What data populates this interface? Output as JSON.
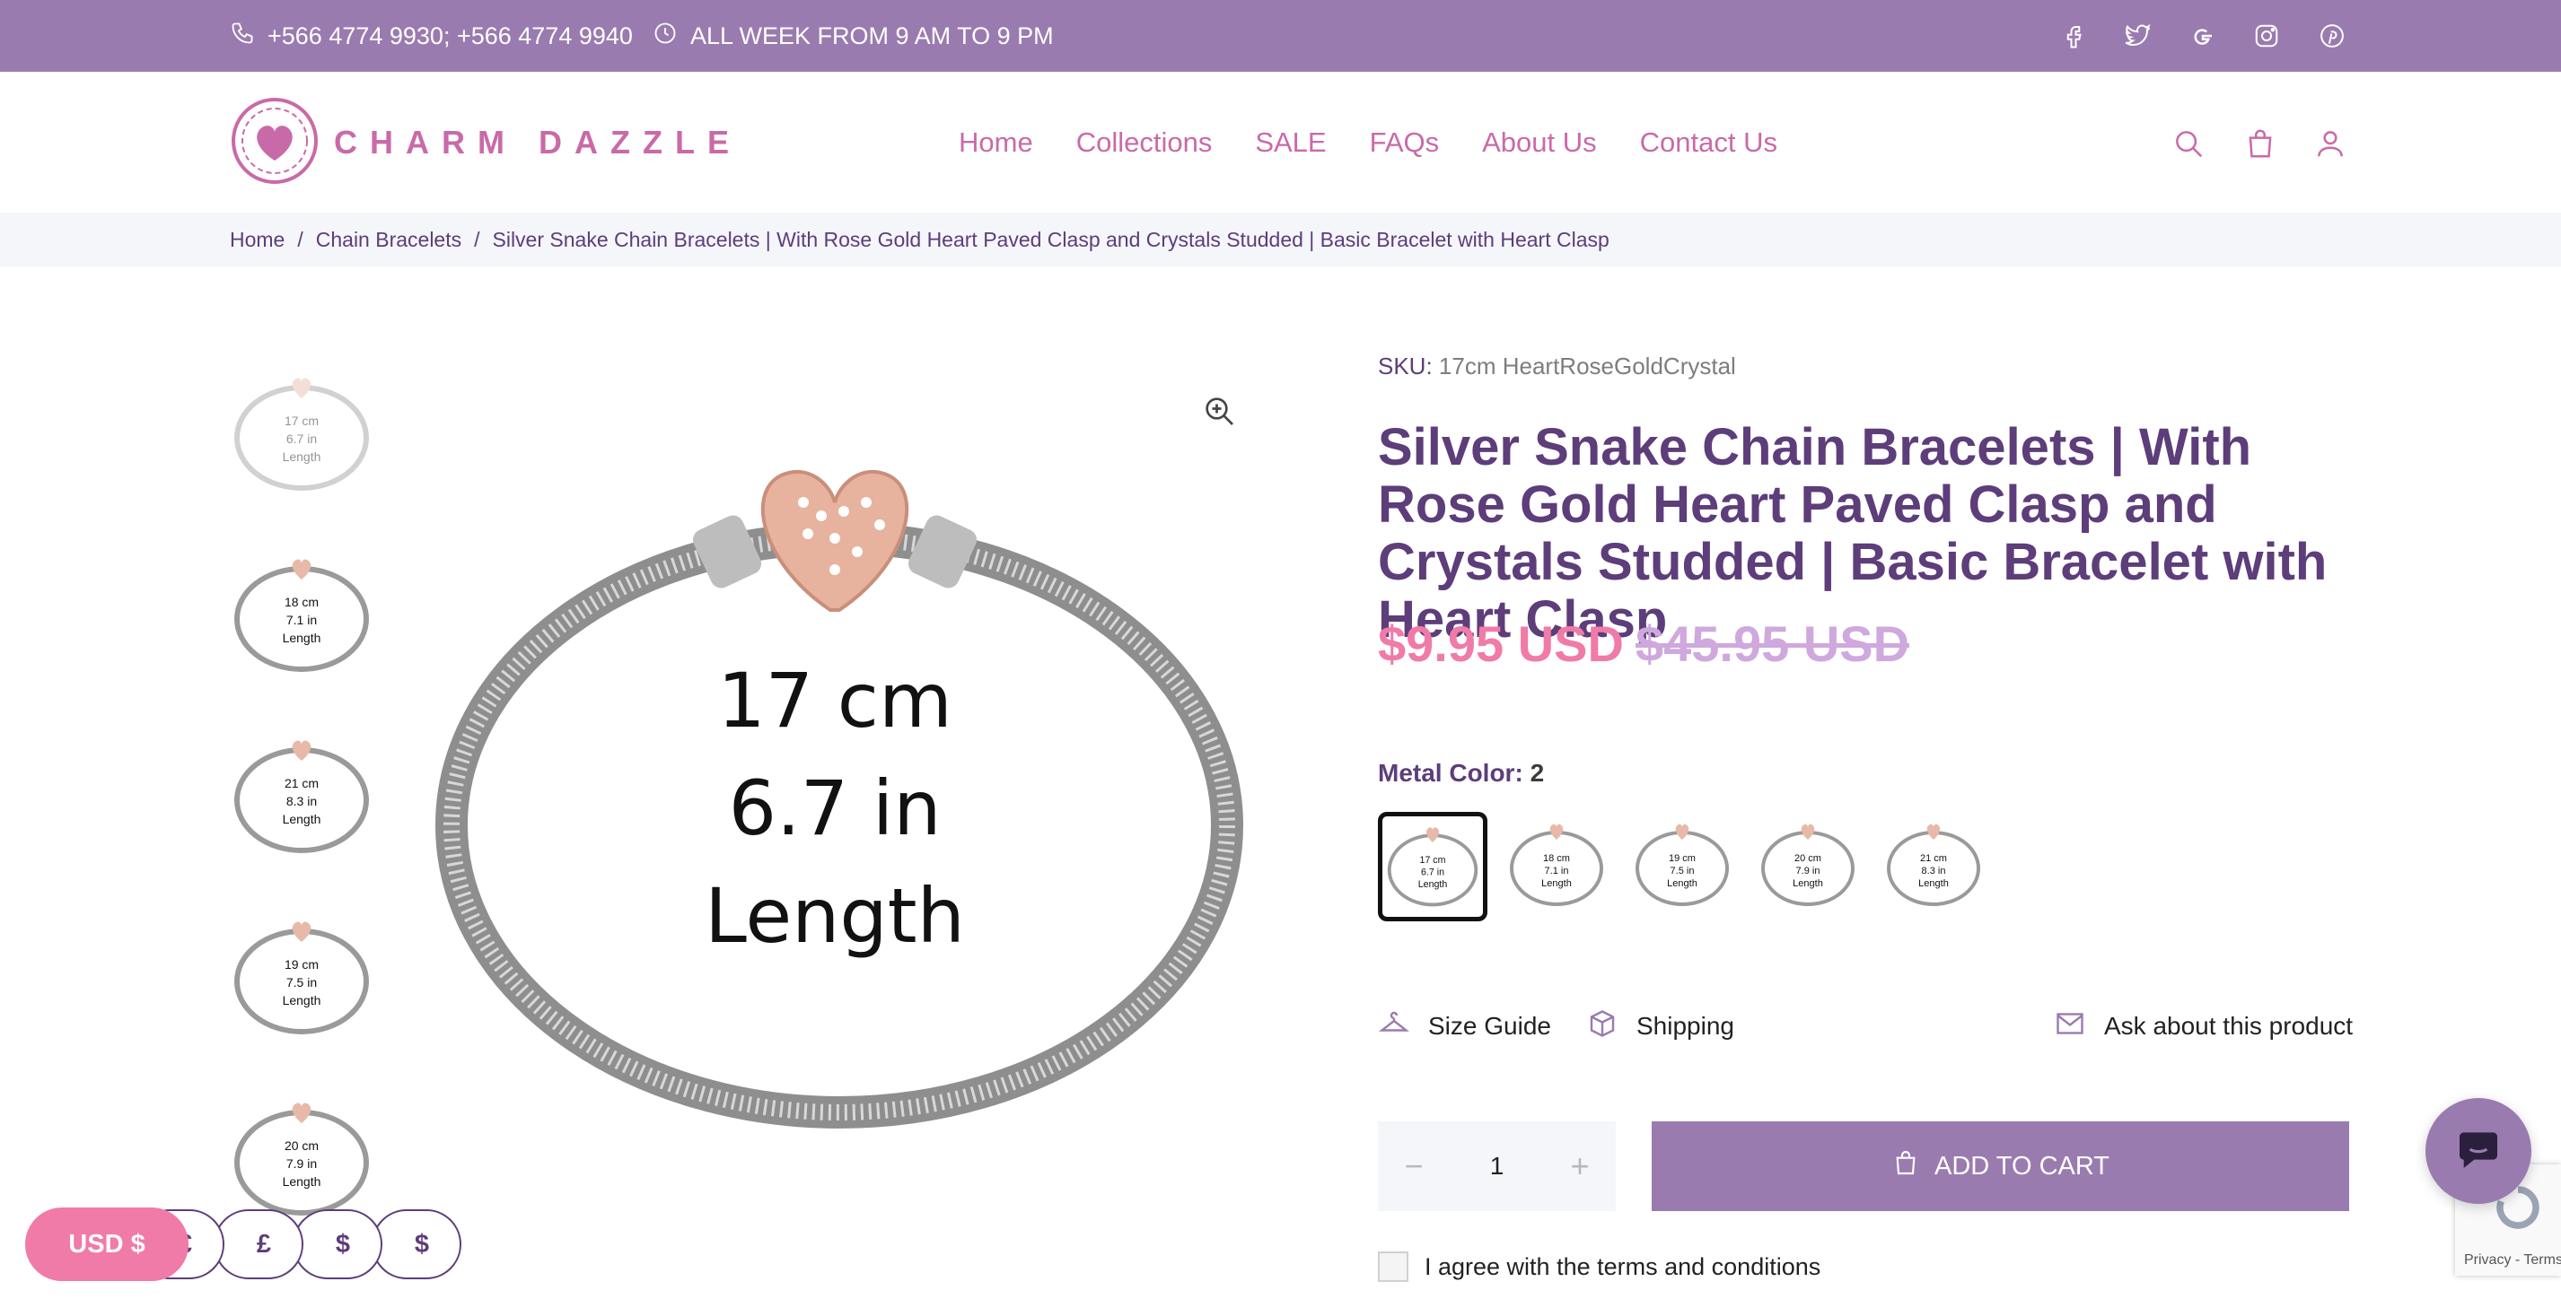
{
  "topbar": {
    "phone": "+566 4774 9930; +566 4774 9940",
    "hours": "ALL WEEK FROM 9 AM TO 9 PM",
    "socials": [
      "facebook-icon",
      "twitter-icon",
      "google-icon",
      "instagram-icon",
      "pinterest-icon"
    ]
  },
  "header": {
    "logo_text": "CHARM DAZZLE",
    "nav": [
      "Home",
      "Collections",
      "SALE",
      "FAQs",
      "About Us",
      "Contact Us"
    ],
    "icons": [
      "search-icon",
      "cart-icon",
      "account-icon"
    ]
  },
  "breadcrumb": {
    "items": [
      "Home",
      "Chain Bracelets",
      "Silver Snake Chain Bracelets | With Rose Gold Heart Paved Clasp and Crystals Studded | Basic Bracelet with Heart Clasp"
    ],
    "separator": "/"
  },
  "gallery": {
    "thumbnails": [
      {
        "cm": "17 cm",
        "inch": "6.7 in",
        "unit": "Length"
      },
      {
        "cm": "18 cm",
        "inch": "7.1 in",
        "unit": "Length"
      },
      {
        "cm": "21 cm",
        "inch": "8.3 in",
        "unit": "Length"
      },
      {
        "cm": "19 cm",
        "inch": "7.5 in",
        "unit": "Length"
      },
      {
        "cm": "20 cm",
        "inch": "7.9 in",
        "unit": "Length"
      }
    ],
    "main": {
      "cm": "17 cm",
      "inch": "6.7 in",
      "unit": "Length"
    }
  },
  "product": {
    "sku_label": "SKU:",
    "sku_value": "17cm HeartRoseGoldCrystal",
    "title": "Silver Snake Chain Bracelets | With Rose Gold Heart Paved Clasp and Crystals Studded | Basic Bracelet with Heart Clasp",
    "price": "$9.95 USD",
    "compare_price": "$45.95 USD",
    "option_label": "Metal Color:",
    "option_value": "2",
    "swatches": [
      {
        "cm": "17 cm",
        "inch": "6.7 in",
        "unit": "Length"
      },
      {
        "cm": "18 cm",
        "inch": "7.1 in",
        "unit": "Length"
      },
      {
        "cm": "19 cm",
        "inch": "7.5 in",
        "unit": "Length"
      },
      {
        "cm": "20 cm",
        "inch": "7.9 in",
        "unit": "Length"
      },
      {
        "cm": "21 cm",
        "inch": "8.3 in",
        "unit": "Length"
      }
    ],
    "links": {
      "size_guide": "Size Guide",
      "shipping": "Shipping",
      "ask": "Ask about this product"
    },
    "quantity": "1",
    "add_to_cart": "ADD TO CART",
    "agree_text": "I agree with the terms and conditions"
  },
  "currency": {
    "selected": "USD $",
    "options": [
      "€",
      "£",
      "$",
      "$"
    ]
  },
  "recaptcha": {
    "text": "Privacy - Terms"
  },
  "colors": {
    "brand_purple": "#9a7bb0",
    "pink": "#f07aa8",
    "dark_purple": "#5d3d7a"
  }
}
